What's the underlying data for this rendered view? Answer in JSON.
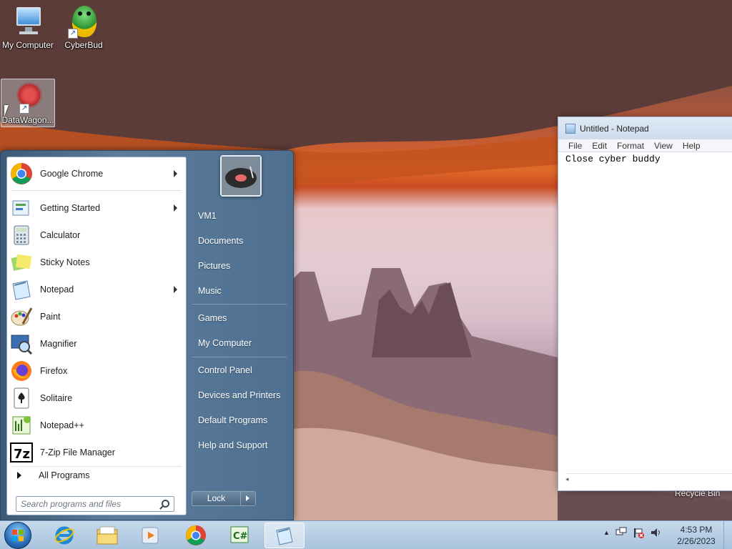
{
  "desktop": {
    "icons": [
      {
        "label": "My Computer"
      },
      {
        "label": "CyberBud"
      },
      {
        "label": "DataWagon..."
      }
    ],
    "recycle_bin": "Recycle Bin"
  },
  "notepad": {
    "title": "Untitled - Notepad",
    "menu": [
      "File",
      "Edit",
      "Format",
      "View",
      "Help"
    ],
    "content": "Close cyber buddy"
  },
  "start_menu": {
    "programs": [
      {
        "label": "Google Chrome",
        "icon": "chrome-icon",
        "has_submenu": true
      },
      {
        "label": "Getting Started",
        "icon": "getting-started-icon",
        "has_submenu": true
      },
      {
        "label": "Calculator",
        "icon": "calculator-icon",
        "has_submenu": false
      },
      {
        "label": "Sticky Notes",
        "icon": "sticky-notes-icon",
        "has_submenu": false
      },
      {
        "label": "Notepad",
        "icon": "notepad-icon",
        "has_submenu": true
      },
      {
        "label": "Paint",
        "icon": "paint-icon",
        "has_submenu": false
      },
      {
        "label": "Magnifier",
        "icon": "magnifier-icon",
        "has_submenu": false
      },
      {
        "label": "Firefox",
        "icon": "firefox-icon",
        "has_submenu": false
      },
      {
        "label": "Solitaire",
        "icon": "solitaire-icon",
        "has_submenu": false
      },
      {
        "label": "Notepad++",
        "icon": "notepadpp-icon",
        "has_submenu": false
      },
      {
        "label": "7-Zip File Manager",
        "icon": "7zip-icon",
        "has_submenu": false
      }
    ],
    "all_programs": "All Programs",
    "search_placeholder": "Search programs and files",
    "right_items": [
      {
        "label": "VM1"
      },
      {
        "label": "Documents"
      },
      {
        "label": "Pictures"
      },
      {
        "label": "Music"
      },
      {
        "label": "Games"
      },
      {
        "label": "My Computer"
      },
      {
        "label": "Control Panel"
      },
      {
        "label": "Devices and Printers"
      },
      {
        "label": "Default Programs"
      },
      {
        "label": "Help and Support"
      }
    ],
    "lock_label": "Lock"
  },
  "taskbar": {
    "pinned": [
      "internet-explorer-icon",
      "file-explorer-icon",
      "media-player-icon",
      "chrome-icon",
      "csharp-icon",
      "notepad-icon"
    ],
    "time": "4:53 PM",
    "date": "2/26/2023"
  }
}
